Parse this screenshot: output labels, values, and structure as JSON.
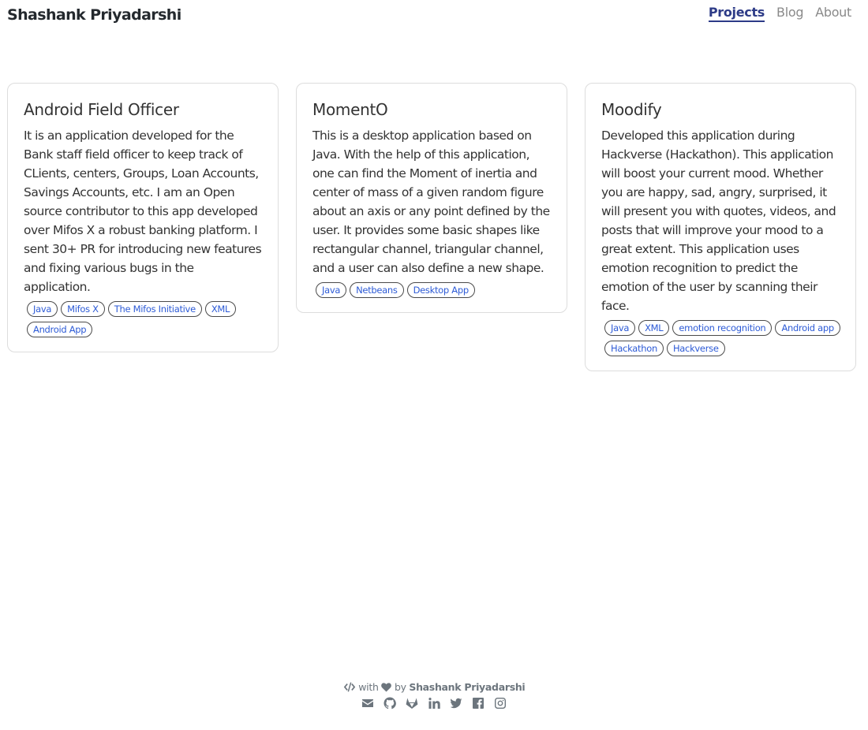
{
  "header": {
    "site_title": "Shashank Priyadarshi",
    "nav": [
      {
        "label": "Projects",
        "active": true
      },
      {
        "label": "Blog",
        "active": false
      },
      {
        "label": "About",
        "active": false
      }
    ]
  },
  "projects": [
    {
      "title": "Android Field Officer",
      "description": "It is an application developed for the Bank staff field officer to keep track of CLients, centers, Groups, Loan Accounts, Savings Accounts, etc. I am an Open source contributor to this app developed over Mifos X a robust banking platform. I sent 30+ PR for introducing new features and fixing various bugs in the application.",
      "tags": [
        "Java",
        "Mifos X",
        "The Mifos Initiative",
        "XML",
        "Android App"
      ]
    },
    {
      "title": "MomentO",
      "description": "This is a desktop application based on Java. With the help of this application, one can find the Moment of inertia and center of mass of a given random figure about an axis or any point defined by the user. It provides some basic shapes like rectangular channel, triangular channel, and a user can also define a new shape.",
      "tags": [
        "Java",
        "Netbeans",
        "Desktop App"
      ]
    },
    {
      "title": "Moodify",
      "description": "Developed this application during Hackverse (Hackathon). This application will boost your current mood. Whether you are happy, sad, angry, surprised, it will present you with quotes, videos, and posts that will improve your mood to a great extent. This application uses emotion recognition to predict the emotion of the user by scanning their face.",
      "tags": [
        "Java",
        "XML",
        "emotion recognition",
        "Android app",
        "Hackathon",
        "Hackverse"
      ]
    }
  ],
  "footer": {
    "with_text": "with",
    "by_text": "by",
    "author": "Shashank Priyadarshi",
    "icons": [
      "code-icon",
      "heart-icon",
      "envelope-icon",
      "github-icon",
      "gitlab-icon",
      "linkedin-icon",
      "twitter-icon",
      "facebook-icon",
      "instagram-icon"
    ]
  }
}
